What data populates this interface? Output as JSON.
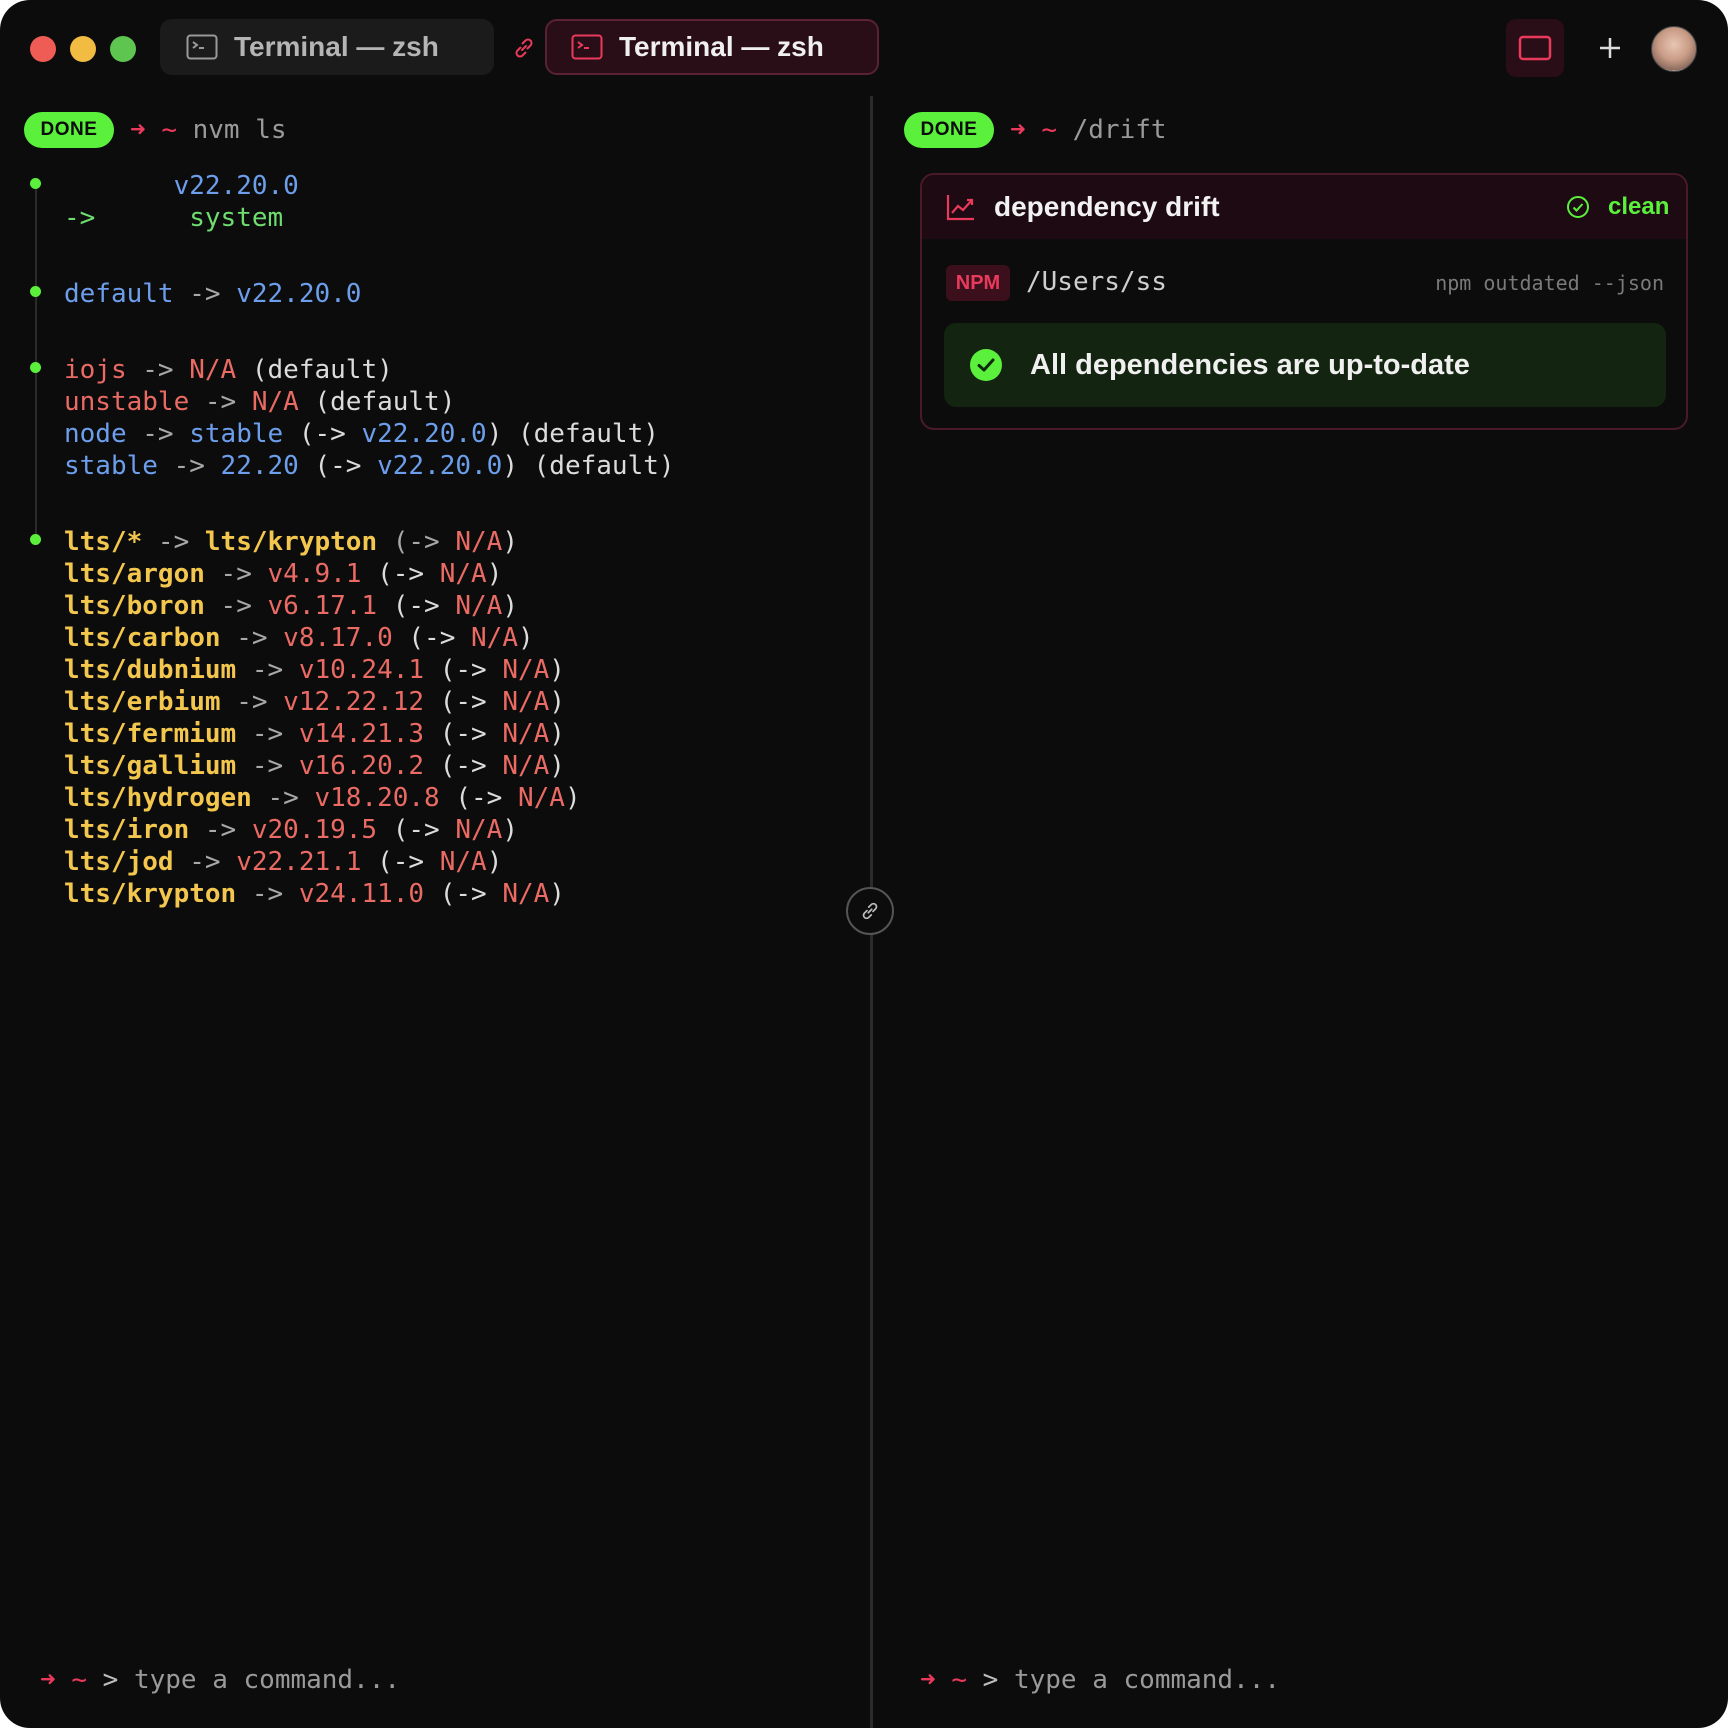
{
  "tabs": [
    {
      "label": "Terminal — zsh",
      "active": false
    },
    {
      "label": "Terminal — zsh",
      "active": true
    }
  ],
  "colors": {
    "accent": "#ea3a5c",
    "done": "#5af03c",
    "background": "#0c0c0c"
  },
  "left_pane": {
    "status": "DONE",
    "arrow": "➜",
    "tilde": "~",
    "command": "nvm ls",
    "output": {
      "g1": [
        [
          {
            "t": "       ",
            "c": "c-white"
          },
          {
            "t": "v22.20.0",
            "c": "c-blue"
          }
        ],
        [
          {
            "t": "->      ",
            "c": "c-green"
          },
          {
            "t": "system",
            "c": "c-green"
          }
        ]
      ],
      "g2": [
        [
          {
            "t": "default",
            "c": "c-blue"
          },
          {
            "t": " -> ",
            "c": "c-gray"
          },
          {
            "t": "v22.20.0",
            "c": "c-blue"
          }
        ]
      ],
      "g3": [
        [
          {
            "t": "iojs",
            "c": "c-red"
          },
          {
            "t": " -> ",
            "c": "c-gray"
          },
          {
            "t": "N/A",
            "c": "c-red"
          },
          {
            "t": " (default)",
            "c": "c-white"
          }
        ],
        [
          {
            "t": "unstable",
            "c": "c-red"
          },
          {
            "t": " -> ",
            "c": "c-gray"
          },
          {
            "t": "N/A",
            "c": "c-red"
          },
          {
            "t": " (default)",
            "c": "c-white"
          }
        ],
        [
          {
            "t": "node",
            "c": "c-blue"
          },
          {
            "t": " -> ",
            "c": "c-gray"
          },
          {
            "t": "stable",
            "c": "c-blue"
          },
          {
            "t": " (-> ",
            "c": "c-white"
          },
          {
            "t": "v22.20.0",
            "c": "c-blue"
          },
          {
            "t": ") (default)",
            "c": "c-white"
          }
        ],
        [
          {
            "t": "stable",
            "c": "c-blue"
          },
          {
            "t": " -> ",
            "c": "c-gray"
          },
          {
            "t": "22.20",
            "c": "c-blue"
          },
          {
            "t": " (-> ",
            "c": "c-white"
          },
          {
            "t": "v22.20.0",
            "c": "c-blue"
          },
          {
            "t": ") (default)",
            "c": "c-white"
          }
        ]
      ],
      "g4": [
        [
          {
            "t": "lts/*",
            "c": "c-yellow"
          },
          {
            "t": " -> ",
            "c": "c-gray"
          },
          {
            "t": "lts/krypton",
            "c": "c-yellow"
          },
          {
            "t": " (-> ",
            "c": "c-gray"
          },
          {
            "t": "N/A",
            "c": "c-red"
          },
          {
            "t": ")",
            "c": "c-white"
          }
        ],
        [
          {
            "t": "lts/argon",
            "c": "c-yellow"
          },
          {
            "t": " -> ",
            "c": "c-gray"
          },
          {
            "t": "v4.9.1",
            "c": "c-red"
          },
          {
            "t": " (-> ",
            "c": "c-white"
          },
          {
            "t": "N/A",
            "c": "c-red"
          },
          {
            "t": ")",
            "c": "c-white"
          }
        ],
        [
          {
            "t": "lts/boron",
            "c": "c-yellow"
          },
          {
            "t": " -> ",
            "c": "c-gray"
          },
          {
            "t": "v6.17.1",
            "c": "c-red"
          },
          {
            "t": " (-> ",
            "c": "c-white"
          },
          {
            "t": "N/A",
            "c": "c-red"
          },
          {
            "t": ")",
            "c": "c-white"
          }
        ],
        [
          {
            "t": "lts/carbon",
            "c": "c-yellow"
          },
          {
            "t": " -> ",
            "c": "c-gray"
          },
          {
            "t": "v8.17.0",
            "c": "c-red"
          },
          {
            "t": " (-> ",
            "c": "c-white"
          },
          {
            "t": "N/A",
            "c": "c-red"
          },
          {
            "t": ")",
            "c": "c-white"
          }
        ],
        [
          {
            "t": "lts/dubnium",
            "c": "c-yellow"
          },
          {
            "t": " -> ",
            "c": "c-gray"
          },
          {
            "t": "v10.24.1",
            "c": "c-red"
          },
          {
            "t": " (-> ",
            "c": "c-white"
          },
          {
            "t": "N/A",
            "c": "c-red"
          },
          {
            "t": ")",
            "c": "c-white"
          }
        ],
        [
          {
            "t": "lts/erbium",
            "c": "c-yellow"
          },
          {
            "t": " -> ",
            "c": "c-gray"
          },
          {
            "t": "v12.22.12",
            "c": "c-red"
          },
          {
            "t": " (-> ",
            "c": "c-white"
          },
          {
            "t": "N/A",
            "c": "c-red"
          },
          {
            "t": ")",
            "c": "c-white"
          }
        ],
        [
          {
            "t": "lts/fermium",
            "c": "c-yellow"
          },
          {
            "t": " -> ",
            "c": "c-gray"
          },
          {
            "t": "v14.21.3",
            "c": "c-red"
          },
          {
            "t": " (-> ",
            "c": "c-white"
          },
          {
            "t": "N/A",
            "c": "c-red"
          },
          {
            "t": ")",
            "c": "c-white"
          }
        ],
        [
          {
            "t": "lts/gallium",
            "c": "c-yellow"
          },
          {
            "t": " -> ",
            "c": "c-gray"
          },
          {
            "t": "v16.20.2",
            "c": "c-red"
          },
          {
            "t": " (-> ",
            "c": "c-white"
          },
          {
            "t": "N/A",
            "c": "c-red"
          },
          {
            "t": ")",
            "c": "c-white"
          }
        ],
        [
          {
            "t": "lts/hydrogen",
            "c": "c-yellow"
          },
          {
            "t": " -> ",
            "c": "c-gray"
          },
          {
            "t": "v18.20.8",
            "c": "c-red"
          },
          {
            "t": " (-> ",
            "c": "c-white"
          },
          {
            "t": "N/A",
            "c": "c-red"
          },
          {
            "t": ")",
            "c": "c-white"
          }
        ],
        [
          {
            "t": "lts/iron",
            "c": "c-yellow"
          },
          {
            "t": " -> ",
            "c": "c-gray"
          },
          {
            "t": "v20.19.5",
            "c": "c-red"
          },
          {
            "t": " (-> ",
            "c": "c-white"
          },
          {
            "t": "N/A",
            "c": "c-red"
          },
          {
            "t": ")",
            "c": "c-white"
          }
        ],
        [
          {
            "t": "lts/jod",
            "c": "c-yellow"
          },
          {
            "t": " -> ",
            "c": "c-gray"
          },
          {
            "t": "v22.21.1",
            "c": "c-red"
          },
          {
            "t": " (-> ",
            "c": "c-white"
          },
          {
            "t": "N/A",
            "c": "c-red"
          },
          {
            "t": ")",
            "c": "c-white"
          }
        ],
        [
          {
            "t": "lts/krypton",
            "c": "c-yellow"
          },
          {
            "t": " -> ",
            "c": "c-gray"
          },
          {
            "t": "v24.11.0",
            "c": "c-red"
          },
          {
            "t": " (-> ",
            "c": "c-white"
          },
          {
            "t": "N/A",
            "c": "c-red"
          },
          {
            "t": ")",
            "c": "c-white"
          }
        ]
      ]
    },
    "input_placeholder": "type a command...",
    "prompt_gt": ">"
  },
  "right_pane": {
    "status": "DONE",
    "arrow": "➜",
    "tilde": "~",
    "command": "/drift",
    "card": {
      "title": "dependency drift",
      "status": "clean",
      "tag": "NPM",
      "path": "/Users/ss",
      "tool_command": "npm outdated --json",
      "message": "All dependencies are up-to-date"
    },
    "input_placeholder": "type a command...",
    "prompt_gt": ">"
  }
}
